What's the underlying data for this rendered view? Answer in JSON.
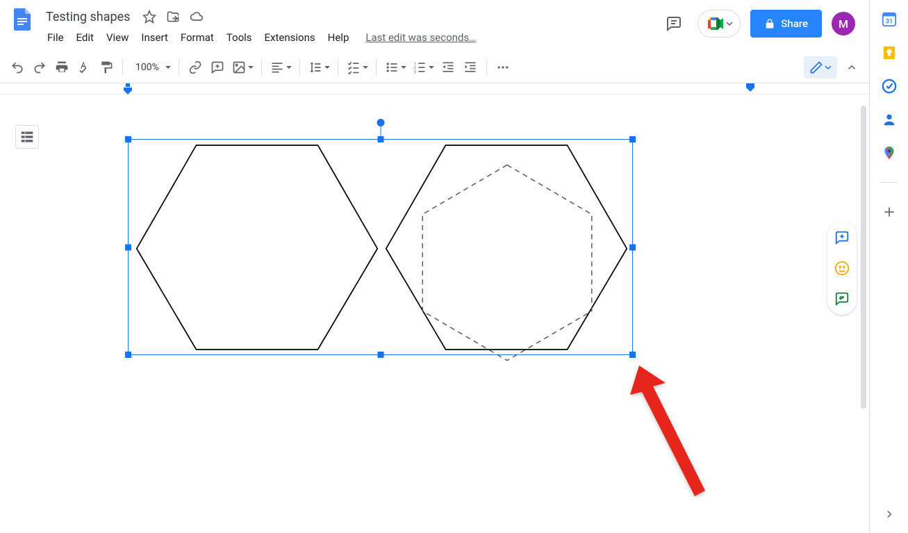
{
  "doc": {
    "title": "Testing shapes"
  },
  "menus": {
    "file": "File",
    "edit": "Edit",
    "view": "View",
    "insert": "Insert",
    "format": "Format",
    "tools": "Tools",
    "extensions": "Extensions",
    "help": "Help"
  },
  "last_edit": "Last edit was seconds…",
  "share": {
    "label": "Share"
  },
  "avatar": {
    "initial": "M"
  },
  "toolbar": {
    "zoom": "100%"
  },
  "colors": {
    "accent": "#1a73e8",
    "share": "#2684fc",
    "avatar_bg": "#9c27b0"
  }
}
